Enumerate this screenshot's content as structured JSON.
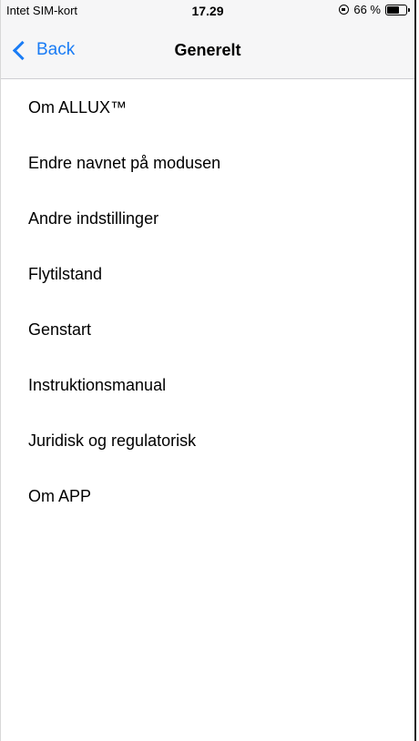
{
  "status_bar": {
    "carrier": "Intet SIM-kort",
    "time": "17.29",
    "battery_text": "66 %",
    "battery_level": 0.66
  },
  "nav": {
    "back_label": "Back",
    "title": "Generelt",
    "accent_color": "#1a7cf5"
  },
  "menu": {
    "items": [
      {
        "label": "Om ALLUX™"
      },
      {
        "label": "Endre navnet på modusen"
      },
      {
        "label": "Andre indstillinger"
      },
      {
        "label": "Flytilstand"
      },
      {
        "label": "Genstart"
      },
      {
        "label": "Instruktionsmanual"
      },
      {
        "label": "Juridisk og regulatorisk"
      },
      {
        "label": "Om APP"
      }
    ]
  }
}
